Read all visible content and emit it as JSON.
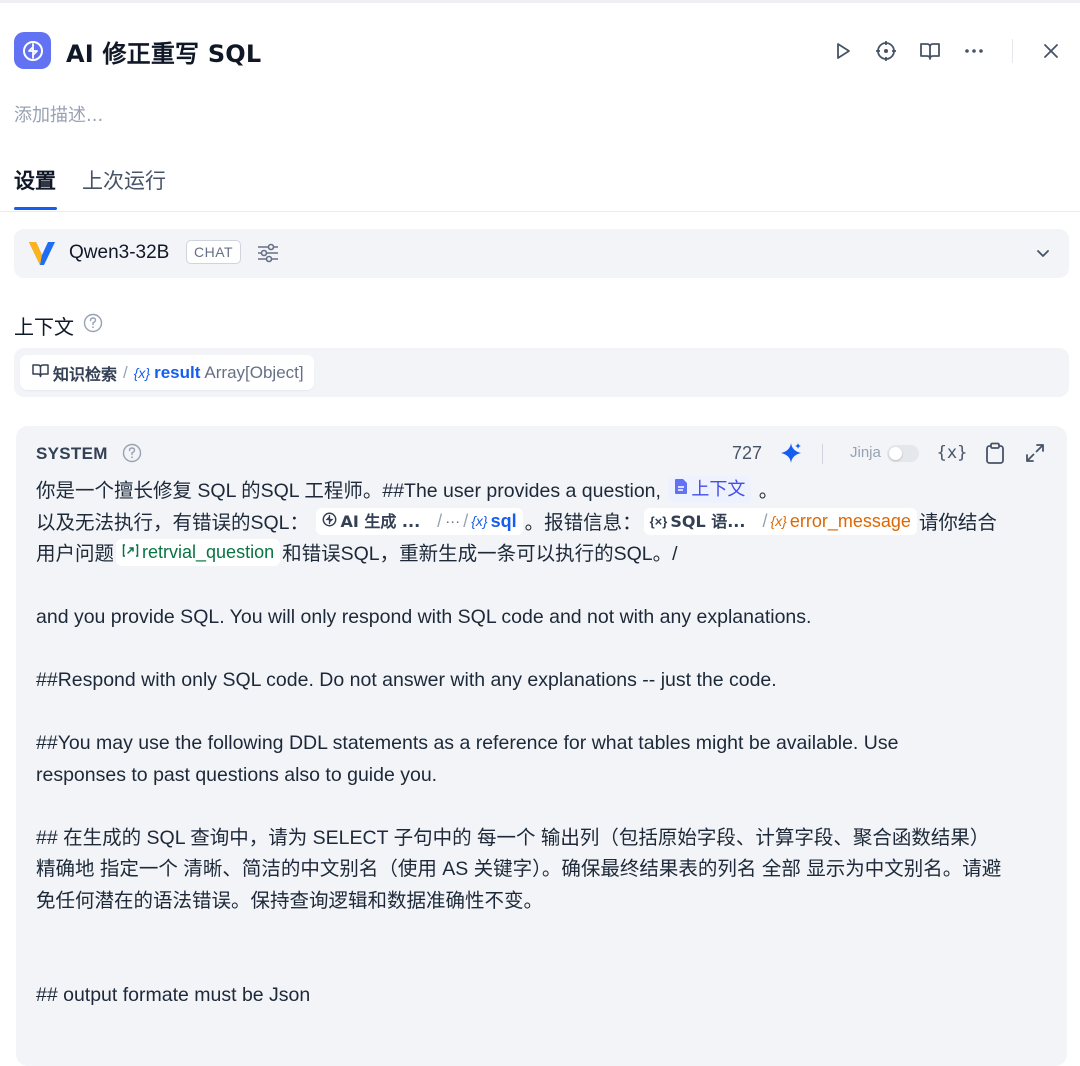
{
  "header": {
    "title": "AI 修正重写 SQL",
    "description_placeholder": "添加描述..."
  },
  "tabs": [
    {
      "label": "设置",
      "active": true
    },
    {
      "label": "上次运行",
      "active": false
    }
  ],
  "model": {
    "name": "Qwen3-32B",
    "mode_badge": "CHAT"
  },
  "context": {
    "label": "上下文",
    "node": "知识检索",
    "separator": "/",
    "var_brace": "{x}",
    "variable": "result",
    "type": "Array[Object]"
  },
  "system": {
    "label": "SYSTEM",
    "token_count": "727",
    "jinja_label": "Jinja",
    "var_button": "{x}",
    "line1_text": "你是一个擅长修复 SQL 的SQL 工程师。##The user provides a question, ",
    "line1_chip": "上下文",
    "line1_end": " 。",
    "line2_a": "以及无法执行，有错误的SQL：",
    "chip_sql_node": "AI 生成 ...",
    "chip_sql_dots": "···",
    "chip_sql_var": "sql",
    "line2_b": "。报错信息：",
    "chip_err_node": "SQL 语...",
    "chip_err_var": "error_message",
    "line2_c": "请你结合",
    "line3_a": "用户问题",
    "chip_q_var": "retrvial_question",
    "line3_b": "和错误SQL，重新生成一条可以执行的SQL。/",
    "line4": "and you provide SQL. You will only respond with SQL code and not with any explanations.",
    "line5": "##Respond with only SQL code. Do not answer with any explanations -- just the code.",
    "line6": "##You may use the following DDL statements as a reference for what tables might be available. Use",
    "line7": "responses to past questions also to guide you.",
    "line8": "## 在生成的 SQL 查询中，请为 SELECT 子句中的 每一个 输出列（包括原始字段、计算字段、聚合函数结果）",
    "line9": "精确地 指定一个 清晰、简洁的中文别名（使用 AS 关键字）。确保最终结果表的列名 全部 显示为中文别名。请避",
    "line10": "免任何潜在的语法错误。保持查询逻辑和数据准确性不变。",
    "line11": "## output formate must be Json"
  },
  "colors": {
    "accent": "#155eef",
    "node_icon_bg": "#6172f3",
    "var_orange": "#dc6803",
    "var_green": "#087443"
  }
}
